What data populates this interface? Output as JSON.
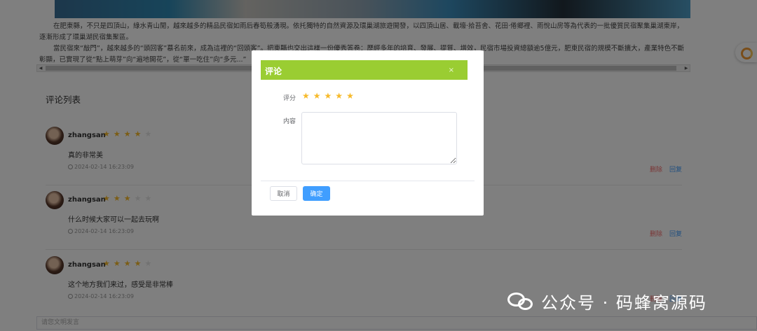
{
  "article": {
    "p1": "在肥東縣，不只是四頂山，綠水青山閒，越來越多的精品民宿如雨后春筍般湧現。依托獨特的自然資源及環巢湖旅遊開發，以四頂山居、載壕·拾苔舍、花田·倦鄉裡、雨悅山房等為代表的一批優質民宿聚集巢湖東岸，逐漸形成了環巢湖民宿集聚區。",
    "p2": "當民宿來“敲門”，越來越多的“頭回客”慕名前來，成為這裡的“回頭客”。把東縣也交出這樣一份優秀答卷：歷經多年的培育、發展、提質、增效，民宿市場投資總額逾5億元，肥東民宿的規模不斷擴大，產業特色不斷彰顯，已實現了從“點上萌芽”向“遍地開花”，從“單一吃住”向“多元...”"
  },
  "comments_title": "评论列表",
  "comments": [
    {
      "user": "zhangsan",
      "rating": 4,
      "text": "真的非常美",
      "time": "2024-02-14 16:23:09",
      "delete": "删除",
      "reply": "回复"
    },
    {
      "user": "zhangsan",
      "rating": 3,
      "text": "什么时候大家可以一起去玩啊",
      "time": "2024-02-14 16:23:09",
      "delete": "删除",
      "reply": "回复"
    },
    {
      "user": "zhangsan",
      "rating": 4,
      "text": "这个地方我们来过，感受是非常棒",
      "time": "2024-02-14 16:23:09",
      "delete": "删除",
      "reply": "回复"
    }
  ],
  "bottom_input": {
    "placeholder": "请您文明发言"
  },
  "dialog": {
    "title": "评论",
    "close": "×",
    "score_label": "评分",
    "rating": 5,
    "content_label": "内容",
    "content_value": "",
    "cancel": "取消",
    "confirm": "确定"
  },
  "watermark": "公众号 · 码蜂窝源码",
  "colors": {
    "dialog_header": "#9acd32",
    "primary": "#409eff",
    "danger": "#f56c6c",
    "star": "#f7ba2a"
  },
  "icons": [
    "close-icon",
    "clock-icon",
    "star-icon",
    "wechat-icon",
    "float-ring-icon"
  ]
}
